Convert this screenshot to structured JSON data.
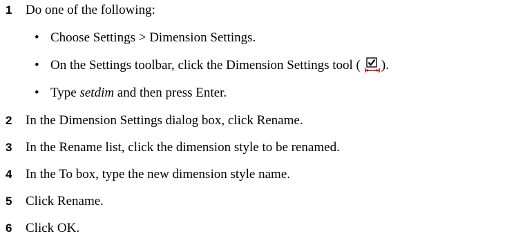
{
  "steps": [
    {
      "number": "1",
      "text": "Do one of the following:",
      "options": [
        {
          "text": "Choose Settings > Dimension Settings."
        },
        {
          "text_before": "On the Settings toolbar, click the Dimension Settings tool (",
          "icon": "dimension-settings-tool-icon",
          "text_after": ")."
        },
        {
          "command": "setdim",
          "text_after": " and then press Enter.",
          "text_before": "Type "
        }
      ]
    },
    {
      "number": "2",
      "text": "In the Dimension Settings dialog box, click Rename."
    },
    {
      "number": "3",
      "text": "In the Rename list, click the dimension style to be renamed."
    },
    {
      "number": "4",
      "text": "In the To box, type the new dimension style name."
    },
    {
      "number": "5",
      "text": "Click Rename."
    },
    {
      "number": "6",
      "text": "Click OK."
    }
  ],
  "colors": {
    "icon_border": "#1a1a1a",
    "icon_check": "#000000",
    "icon_dimension_line": "#cc0000"
  }
}
